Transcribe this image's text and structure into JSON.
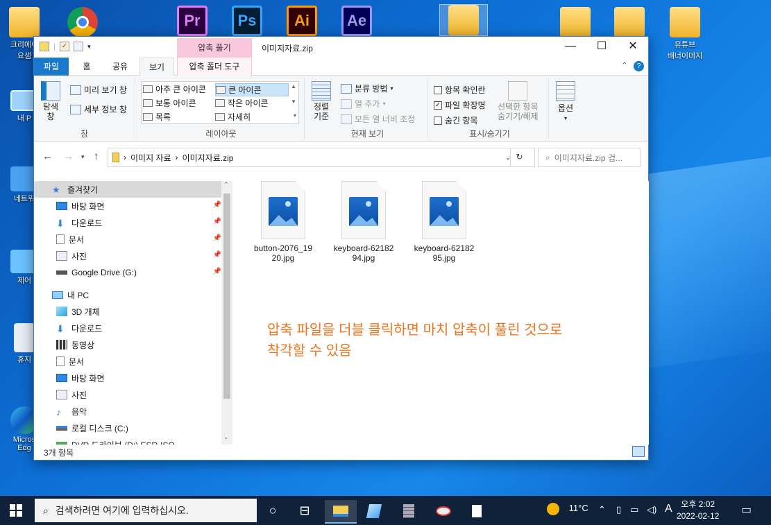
{
  "desktop": {
    "icons": [
      {
        "label": "크리에이\n요샘",
        "kind": "folder"
      },
      {
        "label": "",
        "kind": "chrome"
      },
      {
        "label": "",
        "kind": "premiere",
        "glyph": "Pr"
      },
      {
        "label": "",
        "kind": "photoshop",
        "glyph": "Ps"
      },
      {
        "label": "",
        "kind": "illustrator",
        "glyph": "Ai"
      },
      {
        "label": "",
        "kind": "aftereffects",
        "glyph": "Ae"
      },
      {
        "label": "",
        "kind": "folder"
      },
      {
        "label": "",
        "kind": "folder"
      },
      {
        "label": "",
        "kind": "folder"
      },
      {
        "label": "유튜브\n배너이미지",
        "kind": "folder"
      },
      {
        "label": "내 P",
        "kind": "pc"
      },
      {
        "label": "네트워",
        "kind": "network"
      },
      {
        "label": "제어",
        "kind": "control"
      },
      {
        "label": "휴지",
        "kind": "recycle"
      },
      {
        "label": "Micros\nEdg",
        "kind": "edge"
      }
    ]
  },
  "window": {
    "title": "이미지자료.zip",
    "context_tab_top": "압축 풀기",
    "controls": {
      "minimize": "—",
      "maximize": "☐",
      "close": "✕"
    }
  },
  "ribbon_tabs": [
    "파일",
    "홈",
    "공유",
    "보기",
    "압축 폴더 도구"
  ],
  "ribbon": {
    "pane_group": {
      "label": "창",
      "nav_pane": "탐색\n창",
      "preview_pane": "미리 보기 창",
      "details_pane": "세부 정보 창"
    },
    "layout_group": {
      "label": "레이아웃",
      "items": [
        "아주 큰 아이콘",
        "큰 아이콘",
        "보통 아이콘",
        "작은 아이콘",
        "목록",
        "자세히"
      ],
      "selected": "큰 아이콘"
    },
    "current_view_group": {
      "label": "현재 보기",
      "sort_by": "정렬\n기준",
      "group_by": "분류 방법",
      "add_columns": "열 추가",
      "size_columns": "모든 열 너비 조정"
    },
    "show_hide_group": {
      "label": "표시/숨기기",
      "item_checkboxes": {
        "label": "항목 확인란",
        "checked": false
      },
      "file_extensions": {
        "label": "파일 확장명",
        "checked": true
      },
      "hidden_items": {
        "label": "숨긴 항목",
        "checked": false
      },
      "hide_selected": "선택한 항목\n숨기기/해제"
    },
    "options_group": {
      "label": "옵션"
    }
  },
  "address": {
    "breadcrumb": [
      "이미지 자료",
      "이미지자료.zip"
    ],
    "search_placeholder": "이미지자료.zip 검..."
  },
  "nav_pane": {
    "quick_access": "즐겨찾기",
    "quick_items": [
      {
        "label": "바탕 화면",
        "icon": "desktop-icon"
      },
      {
        "label": "다운로드",
        "icon": "download-icon"
      },
      {
        "label": "문서",
        "icon": "document-icon"
      },
      {
        "label": "사진",
        "icon": "picture-icon"
      },
      {
        "label": "Google Drive (G:)",
        "icon": "drive-icon"
      }
    ],
    "this_pc": "내 PC",
    "pc_items": [
      {
        "label": "3D 개체",
        "icon": "cube-icon"
      },
      {
        "label": "다운로드",
        "icon": "download-icon"
      },
      {
        "label": "동영상",
        "icon": "video-icon"
      },
      {
        "label": "문서",
        "icon": "document-icon"
      },
      {
        "label": "바탕 화면",
        "icon": "desktop-icon"
      },
      {
        "label": "사진",
        "icon": "picture-icon"
      },
      {
        "label": "음악",
        "icon": "music-icon"
      },
      {
        "label": "로컬 디스크 (C:)",
        "icon": "disk-icon"
      },
      {
        "label": "DVD 드라이브 (D:) ESD-ISO",
        "icon": "dvd-icon"
      }
    ]
  },
  "files": [
    {
      "name_line1": "button-2076_19",
      "name_line2": "20.jpg"
    },
    {
      "name_line1": "keyboard-62182",
      "name_line2": "94.jpg"
    },
    {
      "name_line1": "keyboard-62182",
      "name_line2": "95.jpg"
    }
  ],
  "annotation": {
    "line1": "압축 파일을 더블 클릭하면 마치 압축이 풀린 것으로",
    "line2": "착각할 수 있음",
    "color": "#f0741e"
  },
  "status": {
    "item_count": "3개 항목"
  },
  "taskbar": {
    "search_placeholder": "검색하려면 여기에 입력하십시오.",
    "weather": "11°C",
    "ime": "A",
    "time": "오후 2:02",
    "date": "2022-02-12"
  }
}
